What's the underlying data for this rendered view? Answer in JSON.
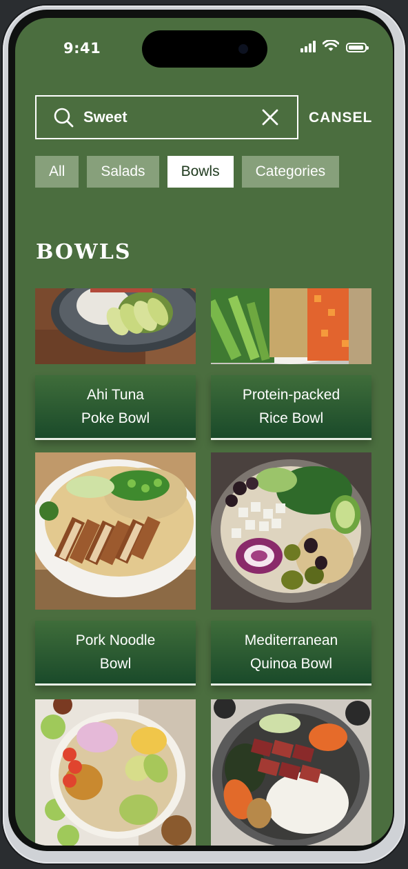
{
  "status": {
    "time": "9:41"
  },
  "search": {
    "value": "Sweet",
    "cancel_label": "CANSEL"
  },
  "tabs": [
    {
      "label": "All",
      "active": false
    },
    {
      "label": "Salads",
      "active": false
    },
    {
      "label": "Bowls",
      "active": true
    },
    {
      "label": "Categories",
      "active": false
    }
  ],
  "section": {
    "title": "BOWLS"
  },
  "cards": [
    {
      "line1": "Ahi Tuna",
      "line2": "Poke Bowl"
    },
    {
      "line1": "Protein-packed",
      "line2": "Rice Bowl"
    },
    {
      "line1": "Pork Noodle",
      "line2": "Bowl"
    },
    {
      "line1": "Mediterranean",
      "line2": "Quinoa Bowl"
    },
    {
      "line1": "",
      "line2": ""
    },
    {
      "line1": "",
      "line2": ""
    }
  ],
  "colors": {
    "screen_bg": "#4b6e3f",
    "tab_bg": "#87a07b",
    "label_top": "#3f6d3a",
    "label_bottom": "#1a4a2a"
  }
}
